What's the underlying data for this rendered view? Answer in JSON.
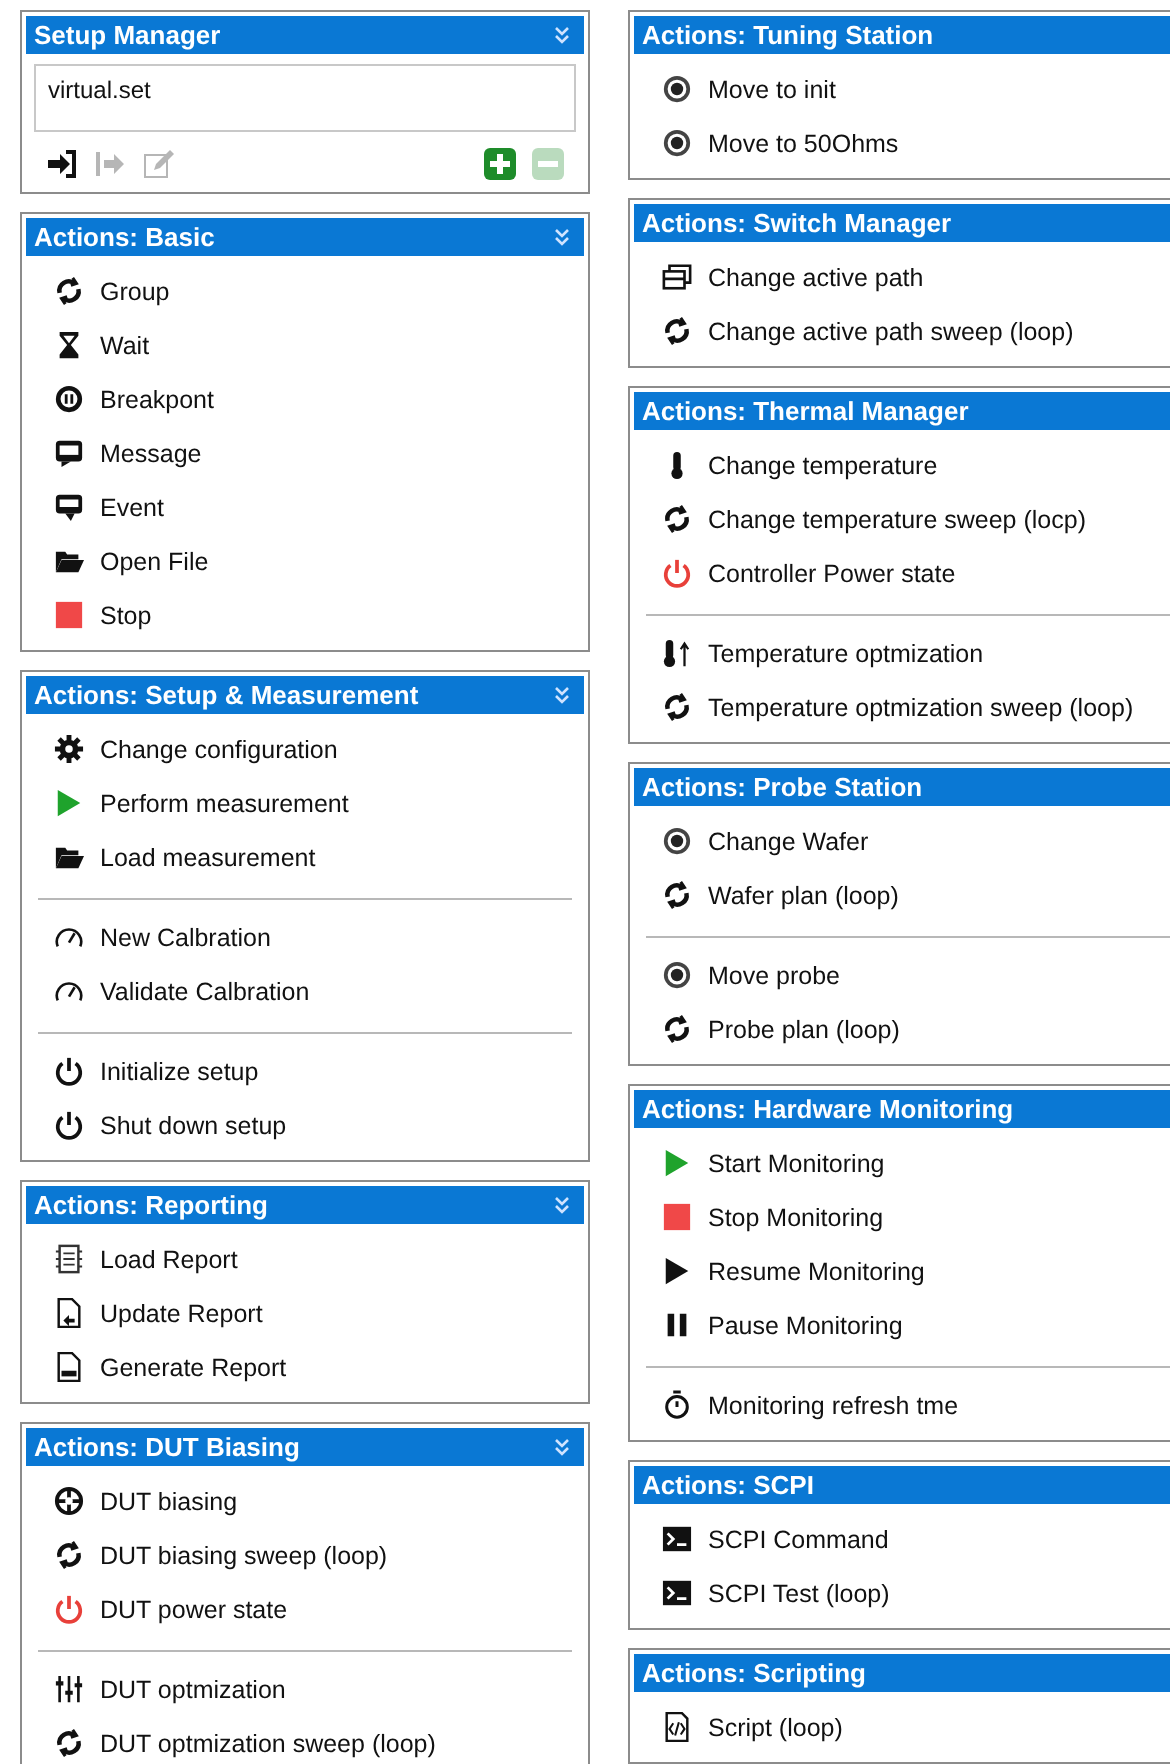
{
  "columns": [
    {
      "panels": [
        {
          "kind": "setup",
          "title": "Setup Manager",
          "chevron": true,
          "value": "virtual.set",
          "tools": [
            {
              "kind": "import",
              "disabled": false
            },
            {
              "kind": "export",
              "disabled": true
            },
            {
              "kind": "edit",
              "disabled": true
            },
            {
              "kind": "add",
              "disabled": false
            },
            {
              "kind": "remove",
              "disabled": true
            }
          ]
        },
        {
          "kind": "actions",
          "title": "Actions: Basic",
          "chevron": true,
          "groups": [
            [
              {
                "kind": "loop",
                "label": "Group"
              },
              {
                "kind": "hourglass",
                "label": "Wait"
              },
              {
                "kind": "breakpoint",
                "label": "Breakpont"
              },
              {
                "kind": "message",
                "label": "Message"
              },
              {
                "kind": "event",
                "label": "Event"
              },
              {
                "kind": "folder",
                "label": "Open File"
              },
              {
                "kind": "stop",
                "label": "Stop"
              }
            ]
          ]
        },
        {
          "kind": "actions",
          "title": "Actions: Setup & Measurement",
          "chevron": true,
          "groups": [
            [
              {
                "kind": "gear",
                "label": "Change configuration"
              },
              {
                "kind": "play-green",
                "label": "Perform measurement"
              },
              {
                "kind": "folder",
                "label": "Load measurement"
              }
            ],
            [
              {
                "kind": "gauge",
                "label": "New Calbration"
              },
              {
                "kind": "gauge",
                "label": "Validate Calbration"
              }
            ],
            [
              {
                "kind": "power",
                "label": "Initialize setup"
              },
              {
                "kind": "power",
                "label": "Shut down setup"
              }
            ]
          ]
        },
        {
          "kind": "actions",
          "title": "Actions: Reporting",
          "chevron": true,
          "groups": [
            [
              {
                "kind": "report-load",
                "label": "Load Report"
              },
              {
                "kind": "report-update",
                "label": "Update Report"
              },
              {
                "kind": "report-pdf",
                "label": "Generate Report"
              }
            ]
          ]
        },
        {
          "kind": "actions",
          "title": "Actions: DUT Biasing",
          "chevron": true,
          "groups": [
            [
              {
                "kind": "bias",
                "label": "DUT biasing"
              },
              {
                "kind": "loop",
                "label": "DUT biasing sweep (loop)"
              },
              {
                "kind": "power-red",
                "label": "DUT power state"
              }
            ],
            [
              {
                "kind": "sliders",
                "label": "DUT optmization"
              },
              {
                "kind": "loop",
                "label": "DUT optmization sweep (loop)"
              }
            ]
          ]
        }
      ]
    },
    {
      "panels": [
        {
          "kind": "actions",
          "title": "Actions: Tuning Station",
          "groups": [
            [
              {
                "kind": "target",
                "label": "Move to init"
              },
              {
                "kind": "target",
                "label": "Move to 50Ohms"
              }
            ]
          ]
        },
        {
          "kind": "actions",
          "title": "Actions: Switch Manager",
          "groups": [
            [
              {
                "kind": "switch",
                "label": "Change active path"
              },
              {
                "kind": "loop",
                "label": "Change active path sweep (loop)"
              }
            ]
          ]
        },
        {
          "kind": "actions",
          "title": "Actions: Thermal Manager",
          "groups": [
            [
              {
                "kind": "thermometer",
                "label": "Change temperature"
              },
              {
                "kind": "loop",
                "label": "Change temperature sweep (locp)"
              },
              {
                "kind": "power-red",
                "label": "Controller Power state"
              }
            ],
            [
              {
                "kind": "thermo-up",
                "label": "Temperature optmization"
              },
              {
                "kind": "loop",
                "label": "Temperature optmization sweep (loop)"
              }
            ]
          ]
        },
        {
          "kind": "actions",
          "title": "Actions: Probe Station",
          "groups": [
            [
              {
                "kind": "target",
                "label": "Change Wafer"
              },
              {
                "kind": "loop",
                "label": "Wafer plan (loop)"
              }
            ],
            [
              {
                "kind": "target",
                "label": "Move probe"
              },
              {
                "kind": "loop",
                "label": "Probe plan (loop)"
              }
            ]
          ]
        },
        {
          "kind": "actions",
          "title": "Actions: Hardware Monitoring",
          "groups": [
            [
              {
                "kind": "play-green",
                "label": "Start Monitoring"
              },
              {
                "kind": "stop",
                "label": "Stop Monitoring"
              },
              {
                "kind": "play",
                "label": "Resume Monitoring"
              },
              {
                "kind": "pause",
                "label": "Pause Monitoring"
              }
            ],
            [
              {
                "kind": "stopwatch",
                "label": "Monitoring refresh tme"
              }
            ]
          ]
        },
        {
          "kind": "actions",
          "title": "Actions: SCPI",
          "groups": [
            [
              {
                "kind": "terminal",
                "label": "SCPI Command"
              },
              {
                "kind": "terminal",
                "label": "SCPI Test (loop)"
              }
            ]
          ]
        },
        {
          "kind": "actions",
          "title": "Actions: Scripting",
          "groups": [
            [
              {
                "kind": "script",
                "label": "Script (loop)"
              }
            ]
          ]
        }
      ]
    }
  ]
}
